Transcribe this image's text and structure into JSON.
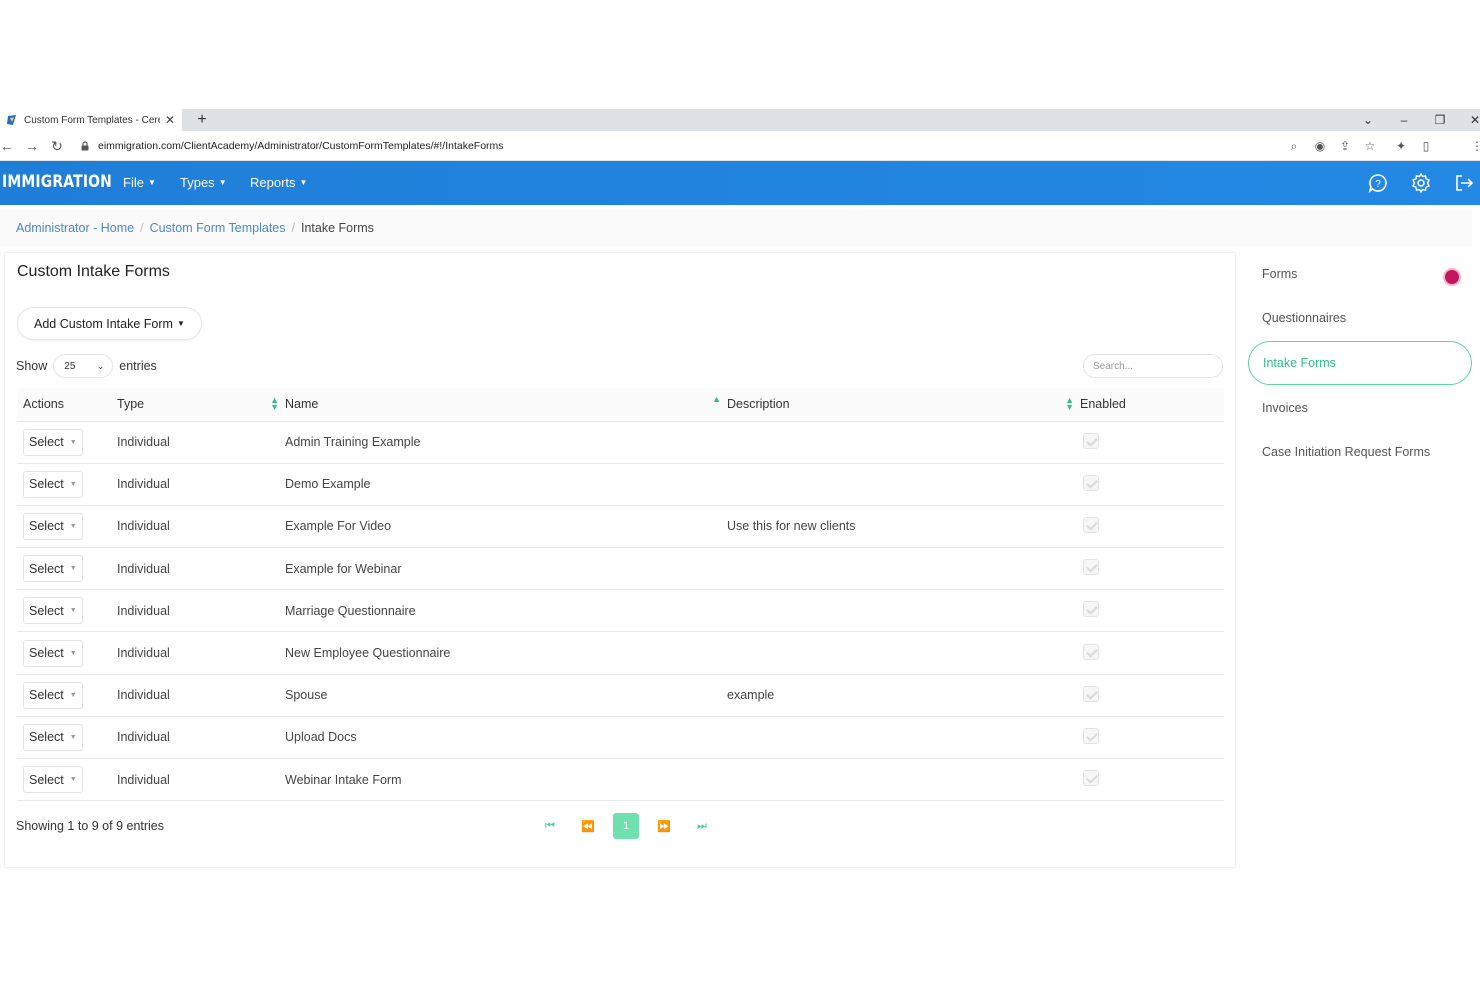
{
  "browser": {
    "tab_title": "Custom Form Templates - Ceren",
    "url": "eimmigration.com/ClientAcademy/Administrator/CustomFormTemplates/#!/IntakeForms"
  },
  "app": {
    "brand": "IMMIGRATION",
    "menus": [
      {
        "label": "File"
      },
      {
        "label": "Types"
      },
      {
        "label": "Reports"
      }
    ]
  },
  "breadcrumb": {
    "items": [
      "Administrator - Home",
      "Custom Form Templates",
      "Intake Forms"
    ]
  },
  "main": {
    "title": "Custom Intake Forms",
    "add_button": "Add Custom Intake Form",
    "show_label": "Show",
    "entries_count": "25",
    "entries_label": "entries",
    "search_placeholder": "Search...",
    "columns": [
      "Actions",
      "Type",
      "Name",
      "Description",
      "Enabled"
    ],
    "select_label": "Select",
    "rows": [
      {
        "type": "Individual",
        "name": "Admin Training Example",
        "description": ""
      },
      {
        "type": "Individual",
        "name": "Demo Example",
        "description": ""
      },
      {
        "type": "Individual",
        "name": "Example For Video",
        "description": "Use this for new clients"
      },
      {
        "type": "Individual",
        "name": "Example for Webinar",
        "description": ""
      },
      {
        "type": "Individual",
        "name": "Marriage Questionnaire",
        "description": ""
      },
      {
        "type": "Individual",
        "name": "New Employee Questionnaire",
        "description": ""
      },
      {
        "type": "Individual",
        "name": "Spouse",
        "description": "example"
      },
      {
        "type": "Individual",
        "name": "Upload Docs",
        "description": ""
      },
      {
        "type": "Individual",
        "name": "Webinar Intake Form",
        "description": ""
      }
    ],
    "showing": "Showing 1 to 9 of 9 entries",
    "current_page": "1"
  },
  "sidebar": {
    "items": [
      {
        "label": "Forms"
      },
      {
        "label": "Questionnaires"
      },
      {
        "label": "Intake Forms"
      },
      {
        "label": "Invoices"
      },
      {
        "label": "Case Initiation Request Forms"
      }
    ]
  },
  "colors": {
    "header_blue": "#1f7ed8",
    "accent_green": "#2fbf87",
    "link_blue": "#4a88c8"
  }
}
